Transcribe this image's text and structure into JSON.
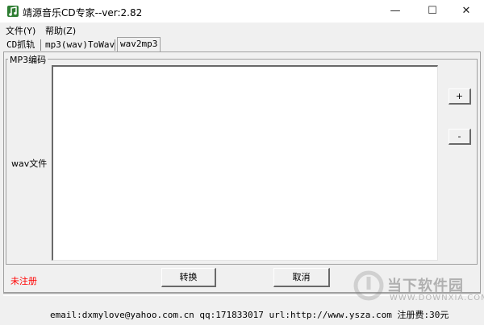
{
  "window": {
    "title": "靖源音乐CD专家--ver:2.82",
    "minimize_glyph": "—",
    "maximize_glyph": "☐",
    "close_glyph": "✕",
    "icon": "music-note-icon"
  },
  "menu": {
    "items": [
      "文件(Y)",
      "帮助(Z)"
    ]
  },
  "tabs": [
    {
      "label": "CD抓轨",
      "active": false
    },
    {
      "label": "mp3(wav)ToWav",
      "active": false
    },
    {
      "label": "wav2mp3",
      "active": true
    }
  ],
  "group": {
    "title": "MP3编码",
    "wav_label": "wav文件",
    "add_label": "+",
    "remove_label": "-"
  },
  "footer": {
    "unregistered": "未注册",
    "convert_label": "转换",
    "cancel_label": "取消"
  },
  "status": {
    "text": "email:dxmylove@yahoo.com.cn qq:171833017 url:http://www.ysza.com 注册费:30元"
  },
  "watermark": {
    "name": "当下软件园",
    "url": "WWW.DOWNXIA.COM",
    "icon": "watermark-logo-icon"
  }
}
